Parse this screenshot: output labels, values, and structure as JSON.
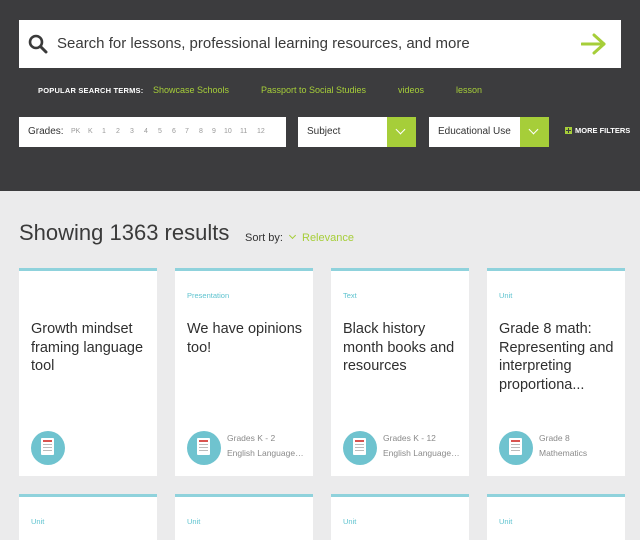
{
  "search": {
    "placeholder": "Search for lessons, professional learning resources, and more"
  },
  "popular": {
    "label": "POPULAR SEARCH TERMS:",
    "terms": [
      "Showcase Schools",
      "Passport to Social Studies",
      "videos",
      "lesson"
    ]
  },
  "filters": {
    "grades_label": "Grades:",
    "grades": [
      "PK",
      "K",
      "1",
      "2",
      "3",
      "4",
      "5",
      "6",
      "7",
      "8",
      "9",
      "10",
      "11",
      "12"
    ],
    "subject": "Subject",
    "educational_use": "Educational Use",
    "more_filters": "MORE FILTERS"
  },
  "results": {
    "heading": "Showing 1363 results",
    "sort_label": "Sort by:",
    "sort_value": "Relevance"
  },
  "cards": [
    {
      "type": "",
      "title": "Growth mindset framing language tool",
      "grades": "",
      "subject": ""
    },
    {
      "type": "Presentation",
      "title": "We have opinions too!",
      "grades": "Grades K - 2",
      "subject": "English Language Arts"
    },
    {
      "type": "Text",
      "title": "Black history month books and resources",
      "grades": "Grades K - 12",
      "subject": "English Language Arts"
    },
    {
      "type": "Unit",
      "title": "Grade 8 math: Representing and interpreting proportiona...",
      "grades": "Grade 8",
      "subject": "Mathematics"
    },
    {
      "type": "Unit"
    },
    {
      "type": "Unit"
    },
    {
      "type": "Unit"
    },
    {
      "type": "Unit"
    }
  ],
  "colors": {
    "accent": "#a6ce39",
    "header_bg": "#3c3c3e",
    "card_border": "#8fd2dc",
    "type_label": "#5ec3cf"
  },
  "icons": {
    "search": "search-icon",
    "go": "arrow-right-icon",
    "resource": "document-icon"
  }
}
